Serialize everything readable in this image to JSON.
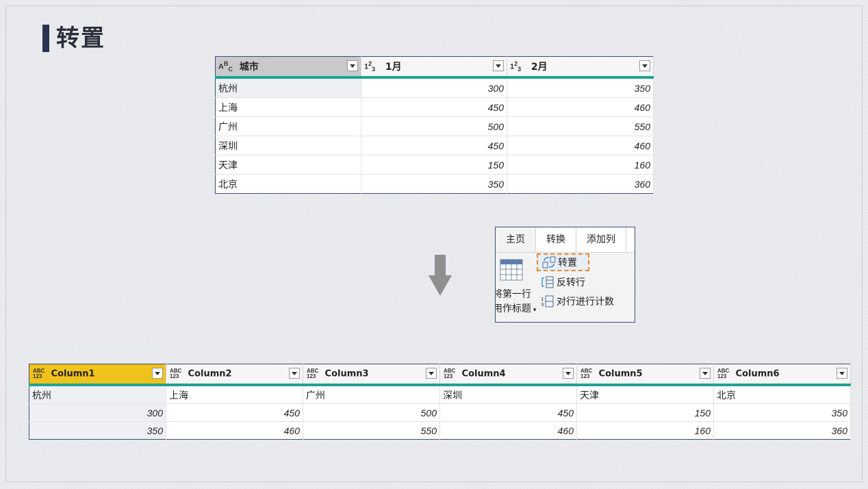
{
  "page": {
    "title": "转置"
  },
  "source_table": {
    "headers": [
      {
        "type": "ABC",
        "label": "城市"
      },
      {
        "type": "123",
        "label": "1月"
      },
      {
        "type": "123",
        "label": "2月"
      }
    ],
    "rows": [
      [
        "杭州",
        "300",
        "350"
      ],
      [
        "上海",
        "450",
        "460"
      ],
      [
        "广州",
        "500",
        "550"
      ],
      [
        "深圳",
        "450",
        "460"
      ],
      [
        "天津",
        "150",
        "160"
      ],
      [
        "北京",
        "350",
        "360"
      ]
    ]
  },
  "ribbon": {
    "tabs": [
      "主页",
      "转换",
      "添加列"
    ],
    "active_tab": "主页",
    "left_label_line1": "将第一行",
    "left_label_line2": "用作标题",
    "items": {
      "transpose": "转置",
      "reverse_rows": "反转行",
      "count_rows": "对行进行计数"
    }
  },
  "result_table": {
    "headers": [
      "Column1",
      "Column2",
      "Column3",
      "Column4",
      "Column5",
      "Column6"
    ],
    "type_label_top": "ABC",
    "type_label_bottom": "123",
    "rows": [
      [
        "杭州",
        "上海",
        "广州",
        "深圳",
        "天津",
        "北京"
      ],
      [
        "300",
        "450",
        "500",
        "450",
        "150",
        "350"
      ],
      [
        "350",
        "460",
        "550",
        "460",
        "160",
        "360"
      ]
    ]
  },
  "colors": {
    "accent_teal": "#1fa38f",
    "selected_header": "#f0c21c",
    "title_bar": "#2b3350",
    "highlight_dash": "#e08a2a"
  }
}
